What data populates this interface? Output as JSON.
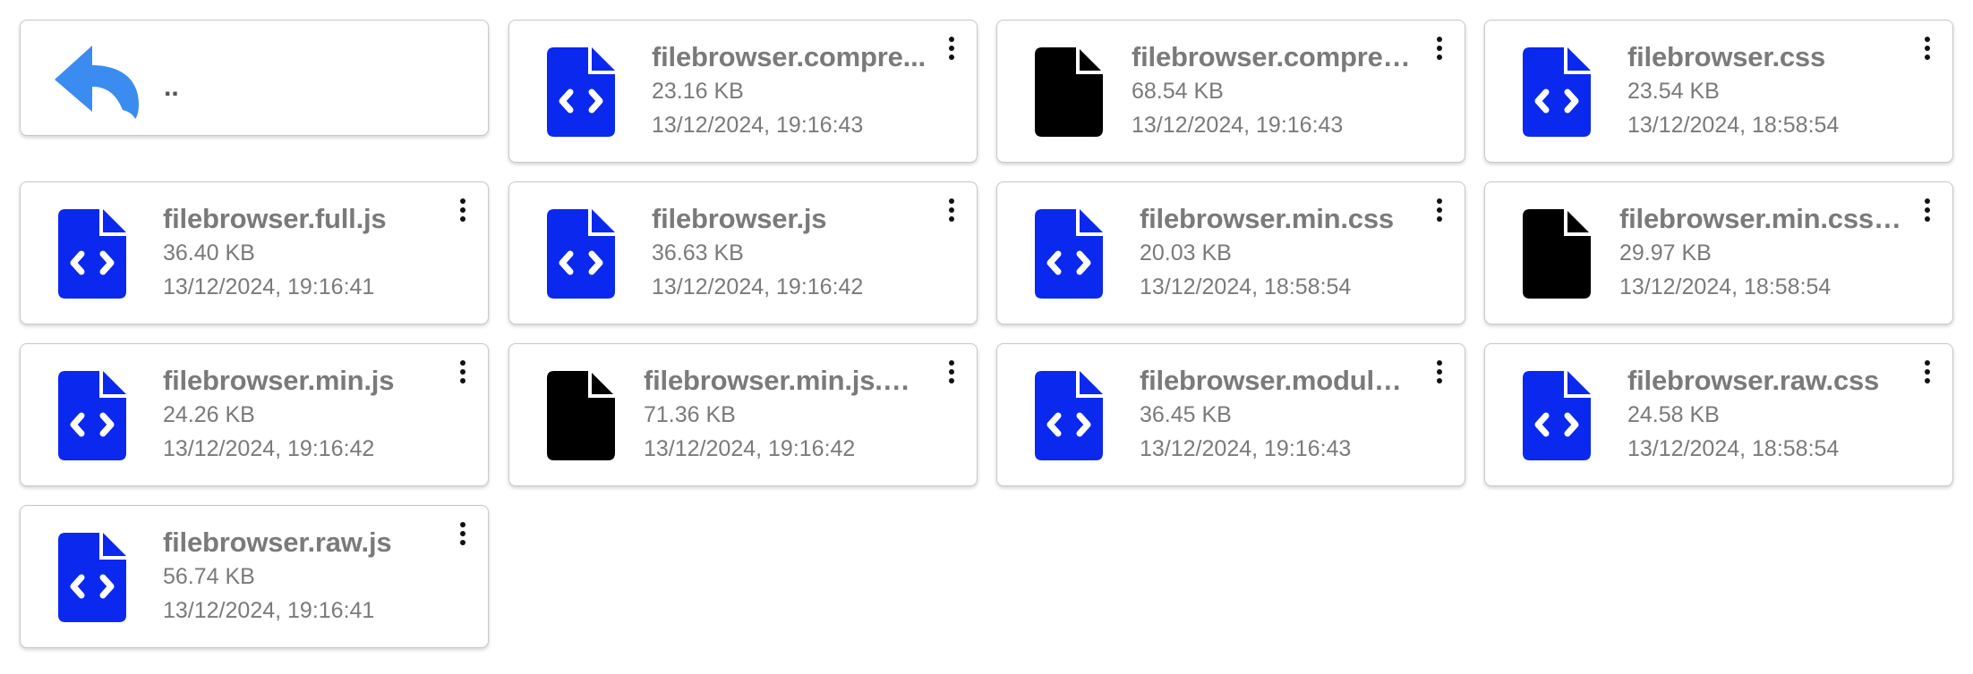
{
  "parent": {
    "label": "..",
    "icon": "reply-back-icon"
  },
  "colors": {
    "code_file": "#0b28ee",
    "binary_file": "#000000",
    "text": "#7a7a7a",
    "back_arrow": "#3b8cf0"
  },
  "files": [
    {
      "name": "filebrowser.compre...",
      "size": "23.16 KB",
      "date": "13/12/2024, 19:16:43",
      "kind": "code"
    },
    {
      "name": "filebrowser.compres...",
      "size": "68.54 KB",
      "date": "13/12/2024, 19:16:43",
      "kind": "binary"
    },
    {
      "name": "filebrowser.css",
      "size": "23.54 KB",
      "date": "13/12/2024, 18:58:54",
      "kind": "code"
    },
    {
      "name": "filebrowser.full.js",
      "size": "36.40 KB",
      "date": "13/12/2024, 19:16:41",
      "kind": "code"
    },
    {
      "name": "filebrowser.js",
      "size": "36.63 KB",
      "date": "13/12/2024, 19:16:42",
      "kind": "code"
    },
    {
      "name": "filebrowser.min.css",
      "size": "20.03 KB",
      "date": "13/12/2024, 18:58:54",
      "kind": "code"
    },
    {
      "name": "filebrowser.min.css....",
      "size": "29.97 KB",
      "date": "13/12/2024, 18:58:54",
      "kind": "binary"
    },
    {
      "name": "filebrowser.min.js",
      "size": "24.26 KB",
      "date": "13/12/2024, 19:16:42",
      "kind": "code"
    },
    {
      "name": "filebrowser.min.js.m...",
      "size": "71.36 KB",
      "date": "13/12/2024, 19:16:42",
      "kind": "binary"
    },
    {
      "name": "filebrowser.module.js",
      "size": "36.45 KB",
      "date": "13/12/2024, 19:16:43",
      "kind": "code"
    },
    {
      "name": "filebrowser.raw.css",
      "size": "24.58 KB",
      "date": "13/12/2024, 18:58:54",
      "kind": "code"
    },
    {
      "name": "filebrowser.raw.js",
      "size": "56.74 KB",
      "date": "13/12/2024, 19:16:41",
      "kind": "code"
    }
  ]
}
